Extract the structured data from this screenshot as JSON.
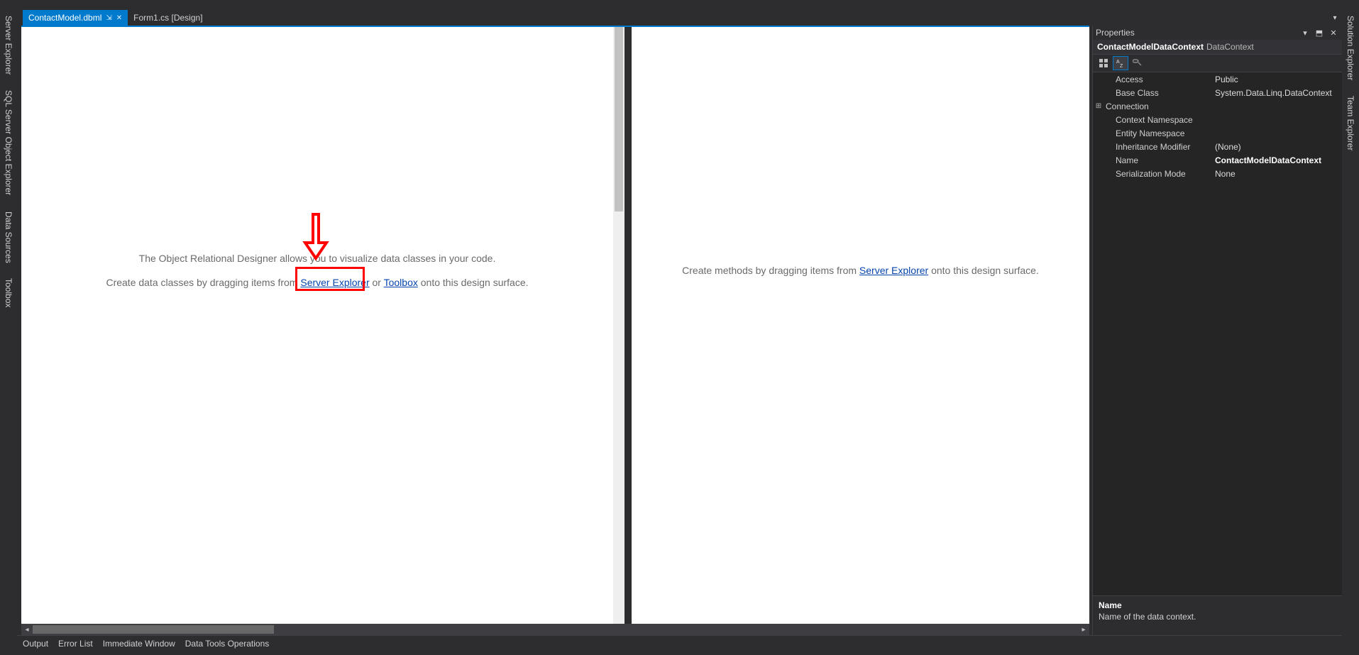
{
  "leftStrip": {
    "tabs": [
      "Server Explorer",
      "SQL Server Object Explorer",
      "Data Sources",
      "Toolbox"
    ]
  },
  "rightStrip": {
    "tabs": [
      "Solution Explorer",
      "Team Explorer"
    ]
  },
  "docTabs": {
    "active": {
      "label": "ContactModel.dbml"
    },
    "others": [
      {
        "label": "Form1.cs [Design]"
      }
    ]
  },
  "designer": {
    "line1": "The Object Relational Designer allows you to visualize data classes in your code.",
    "line2_pre": "Create data classes by dragging items from ",
    "line2_link1": "Server Explorer",
    "line2_mid": " or ",
    "line2_link2": "Toolbox",
    "line2_post": " onto this design surface.",
    "methods_pre": "Create methods by dragging items from ",
    "methods_link": "Server Explorer",
    "methods_post": " onto this design surface."
  },
  "properties": {
    "title": "Properties",
    "objectName": "ContactModelDataContext",
    "objectType": "DataContext",
    "rows": {
      "access": {
        "key": "Access",
        "val": "Public"
      },
      "baseClass": {
        "key": "Base Class",
        "val": "System.Data.Linq.DataContext"
      },
      "connection": {
        "key": "Connection",
        "val": ""
      },
      "contextNs": {
        "key": "Context Namespace",
        "val": ""
      },
      "entityNs": {
        "key": "Entity Namespace",
        "val": ""
      },
      "inheritMod": {
        "key": "Inheritance Modifier",
        "val": "(None)"
      },
      "name": {
        "key": "Name",
        "val": "ContactModelDataContext"
      },
      "serialMode": {
        "key": "Serialization Mode",
        "val": "None"
      }
    },
    "desc": {
      "header": "Name",
      "body": "Name of the data context."
    }
  },
  "bottomTabs": [
    "Output",
    "Error List",
    "Immediate Window",
    "Data Tools Operations"
  ]
}
